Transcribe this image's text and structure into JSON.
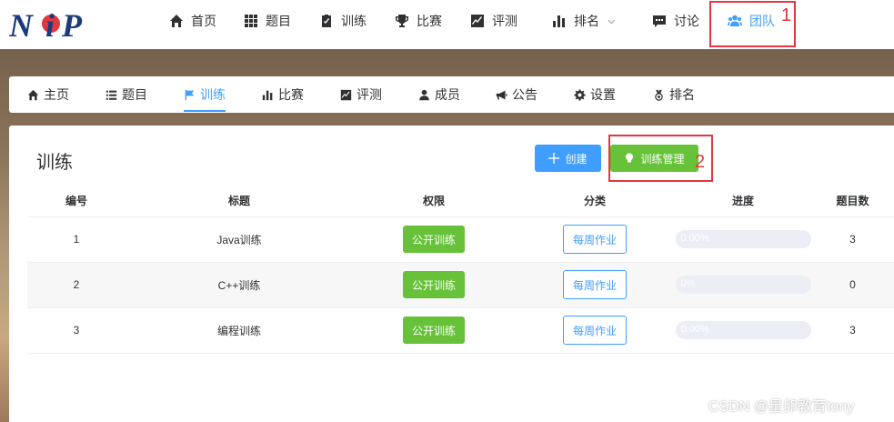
{
  "topnav": {
    "items": [
      {
        "label": "首页",
        "icon": "home-icon"
      },
      {
        "label": "题目",
        "icon": "grid-icon"
      },
      {
        "label": "训练",
        "icon": "clipboard-icon"
      },
      {
        "label": "比赛",
        "icon": "trophy-icon"
      },
      {
        "label": "评测",
        "icon": "chart-line-icon"
      },
      {
        "label": "排名",
        "icon": "bar-chart-icon"
      },
      {
        "label": "讨论",
        "icon": "comment-icon"
      },
      {
        "label": "团队",
        "icon": "users-icon"
      }
    ],
    "active": "团队",
    "annotation_1": "1"
  },
  "subnav": {
    "items": [
      {
        "label": "主页",
        "icon": "home-icon"
      },
      {
        "label": "题目",
        "icon": "list-icon"
      },
      {
        "label": "训练",
        "icon": "flag-icon"
      },
      {
        "label": "比赛",
        "icon": "bar-chart-icon"
      },
      {
        "label": "评测",
        "icon": "chart-line-icon"
      },
      {
        "label": "成员",
        "icon": "user-icon"
      },
      {
        "label": "公告",
        "icon": "bullhorn-icon"
      },
      {
        "label": "设置",
        "icon": "gear-icon"
      },
      {
        "label": "排名",
        "icon": "medal-icon"
      }
    ],
    "active": "训练"
  },
  "main": {
    "title": "训练",
    "create_label": "创建",
    "manage_label": "训练管理",
    "annotation_2": "2",
    "columns": [
      "编号",
      "标题",
      "权限",
      "分类",
      "进度",
      "题目数"
    ],
    "rows": [
      {
        "id": "1",
        "title": "Java训练",
        "permission": "公开训练",
        "category": "每周作业",
        "progress_text": "0.00%",
        "progress": 0,
        "count": "3"
      },
      {
        "id": "2",
        "title": "C++训练",
        "permission": "公开训练",
        "category": "每周作业",
        "progress_text": "0%",
        "progress": 0,
        "count": "0"
      },
      {
        "id": "3",
        "title": "编程训练",
        "permission": "公开训练",
        "category": "每周作业",
        "progress_text": "0.00%",
        "progress": 0,
        "count": "3"
      }
    ]
  },
  "watermark": "CSDN @星卯教育tony",
  "colors": {
    "accent": "#409eff",
    "success": "#67c23a",
    "highlight": "#e0383e"
  }
}
